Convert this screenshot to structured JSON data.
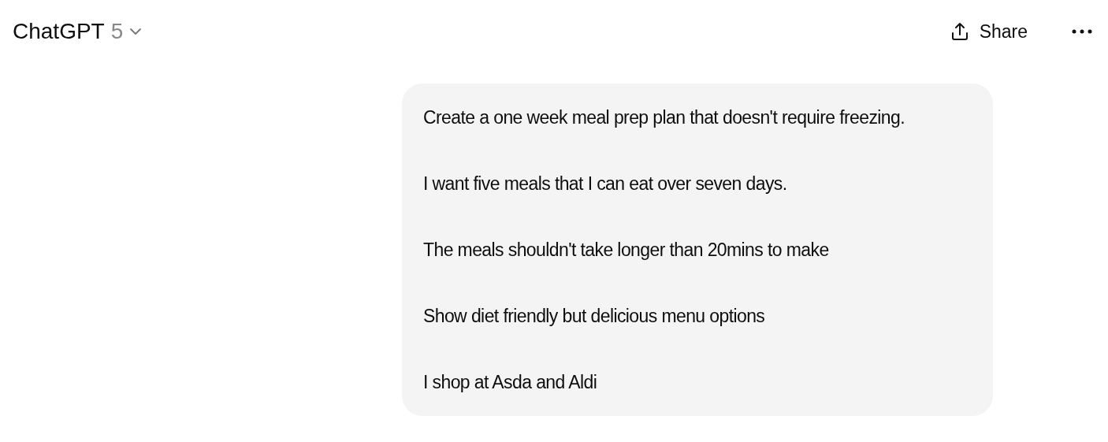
{
  "header": {
    "title": "ChatGPT",
    "version": "5",
    "share_label": "Share"
  },
  "message": {
    "paragraphs": [
      "Create a one week meal prep plan that doesn't require freezing.",
      "I want five meals that I can eat over seven days.",
      "The meals shouldn't take longer than 20mins to make",
      "Show diet friendly but delicious menu options",
      "I shop at Asda and Aldi"
    ]
  }
}
